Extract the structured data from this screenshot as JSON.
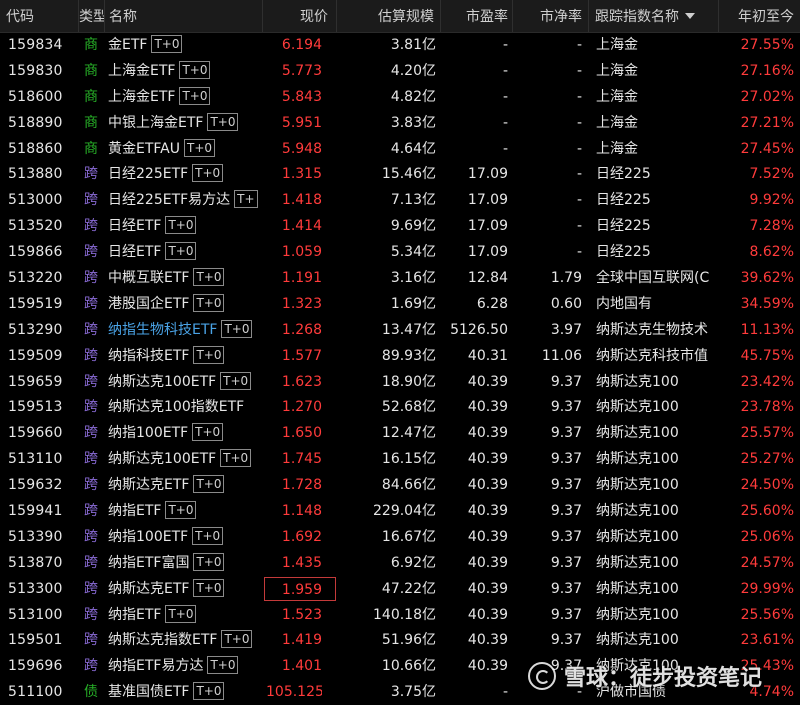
{
  "header": {
    "code": "代码",
    "type": "类型",
    "name": "名称",
    "price": "现价",
    "scale": "估算规模",
    "pe": "市盈率",
    "pb": "市净率",
    "index": "跟踪指数名称",
    "ytd": "年初至今"
  },
  "rows": [
    {
      "code": "159834",
      "tag": "商",
      "name": "金ETF",
      "t0": "T+0",
      "price": "6.194",
      "scale": "3.81亿",
      "pe": "-",
      "pb": "-",
      "index": "上海金",
      "ytd": "27.55%"
    },
    {
      "code": "159830",
      "tag": "商",
      "name": "上海金ETF",
      "t0": "T+0",
      "price": "5.773",
      "scale": "4.20亿",
      "pe": "-",
      "pb": "-",
      "index": "上海金",
      "ytd": "27.16%"
    },
    {
      "code": "518600",
      "tag": "商",
      "name": "上海金ETF",
      "t0": "T+0",
      "price": "5.843",
      "scale": "4.82亿",
      "pe": "-",
      "pb": "-",
      "index": "上海金",
      "ytd": "27.02%"
    },
    {
      "code": "518890",
      "tag": "商",
      "name": "中银上海金ETF",
      "t0": "T+0",
      "price": "5.951",
      "scale": "3.83亿",
      "pe": "-",
      "pb": "-",
      "index": "上海金",
      "ytd": "27.21%"
    },
    {
      "code": "518860",
      "tag": "商",
      "name": "黄金ETFAU",
      "t0": "T+0",
      "price": "5.948",
      "scale": "4.64亿",
      "pe": "-",
      "pb": "-",
      "index": "上海金",
      "ytd": "27.45%"
    },
    {
      "code": "513880",
      "tag": "跨",
      "name": "日经225ETF",
      "t0": "T+0",
      "price": "1.315",
      "scale": "15.46亿",
      "pe": "17.09",
      "pb": "-",
      "index": "日经225",
      "ytd": "7.52%"
    },
    {
      "code": "513000",
      "tag": "跨",
      "name": "日经225ETF易方达",
      "t0": "T+",
      "price": "1.418",
      "scale": "7.13亿",
      "pe": "17.09",
      "pb": "-",
      "index": "日经225",
      "ytd": "9.92%"
    },
    {
      "code": "513520",
      "tag": "跨",
      "name": "日经ETF",
      "t0": "T+0",
      "price": "1.414",
      "scale": "9.69亿",
      "pe": "17.09",
      "pb": "-",
      "index": "日经225",
      "ytd": "7.28%"
    },
    {
      "code": "159866",
      "tag": "跨",
      "name": "日经ETF",
      "t0": "T+0",
      "price": "1.059",
      "scale": "5.34亿",
      "pe": "17.09",
      "pb": "-",
      "index": "日经225",
      "ytd": "8.62%"
    },
    {
      "code": "513220",
      "tag": "跨",
      "name": "中概互联ETF",
      "t0": "T+0",
      "price": "1.191",
      "scale": "3.16亿",
      "pe": "12.84",
      "pb": "1.79",
      "index": "全球中国互联网(C",
      "ytd": "39.62%"
    },
    {
      "code": "159519",
      "tag": "跨",
      "name": "港股国企ETF",
      "t0": "T+0",
      "price": "1.323",
      "scale": "1.69亿",
      "pe": "6.28",
      "pb": "0.60",
      "index": "内地国有",
      "ytd": "34.59%"
    },
    {
      "code": "513290",
      "tag": "跨",
      "name": "纳指生物科技ETF",
      "t0": "T+0",
      "price": "1.268",
      "scale": "13.47亿",
      "pe": "5126.50",
      "pb": "3.97",
      "index": "纳斯达克生物技术",
      "ytd": "11.13%",
      "blue": true
    },
    {
      "code": "159509",
      "tag": "跨",
      "name": "纳指科技ETF",
      "t0": "T+0",
      "price": "1.577",
      "scale": "89.93亿",
      "pe": "40.31",
      "pb": "11.06",
      "index": "纳斯达克科技市值",
      "ytd": "45.75%"
    },
    {
      "code": "159659",
      "tag": "跨",
      "name": "纳斯达克100ETF",
      "t0": "T+0",
      "price": "1.623",
      "scale": "18.90亿",
      "pe": "40.39",
      "pb": "9.37",
      "index": "纳斯达克100",
      "ytd": "23.42%"
    },
    {
      "code": "159513",
      "tag": "跨",
      "name": "纳斯达克100指数ETF",
      "t0": "",
      "price": "1.270",
      "scale": "52.68亿",
      "pe": "40.39",
      "pb": "9.37",
      "index": "纳斯达克100",
      "ytd": "23.78%"
    },
    {
      "code": "159660",
      "tag": "跨",
      "name": "纳指100ETF",
      "t0": "T+0",
      "price": "1.650",
      "scale": "12.47亿",
      "pe": "40.39",
      "pb": "9.37",
      "index": "纳斯达克100",
      "ytd": "25.57%"
    },
    {
      "code": "513110",
      "tag": "跨",
      "name": "纳斯达克100ETF",
      "t0": "T+0",
      "price": "1.745",
      "scale": "16.15亿",
      "pe": "40.39",
      "pb": "9.37",
      "index": "纳斯达克100",
      "ytd": "25.27%"
    },
    {
      "code": "159632",
      "tag": "跨",
      "name": "纳斯达克ETF",
      "t0": "T+0",
      "price": "1.728",
      "scale": "84.66亿",
      "pe": "40.39",
      "pb": "9.37",
      "index": "纳斯达克100",
      "ytd": "24.50%"
    },
    {
      "code": "159941",
      "tag": "跨",
      "name": "纳指ETF",
      "t0": "T+0",
      "price": "1.148",
      "scale": "229.04亿",
      "pe": "40.39",
      "pb": "9.37",
      "index": "纳斯达克100",
      "ytd": "25.60%"
    },
    {
      "code": "513390",
      "tag": "跨",
      "name": "纳指100ETF",
      "t0": "T+0",
      "price": "1.692",
      "scale": "16.67亿",
      "pe": "40.39",
      "pb": "9.37",
      "index": "纳斯达克100",
      "ytd": "25.06%"
    },
    {
      "code": "513870",
      "tag": "跨",
      "name": "纳指ETF富国",
      "t0": "T+0",
      "price": "1.435",
      "scale": "6.92亿",
      "pe": "40.39",
      "pb": "9.37",
      "index": "纳斯达克100",
      "ytd": "24.57%"
    },
    {
      "code": "513300",
      "tag": "跨",
      "name": "纳斯达克ETF",
      "t0": "T+0",
      "price": "1.959",
      "scale": "47.22亿",
      "pe": "40.39",
      "pb": "9.37",
      "index": "纳斯达克100",
      "ytd": "29.99%",
      "selected": true
    },
    {
      "code": "513100",
      "tag": "跨",
      "name": "纳指ETF",
      "t0": "T+0",
      "price": "1.523",
      "scale": "140.18亿",
      "pe": "40.39",
      "pb": "9.37",
      "index": "纳斯达克100",
      "ytd": "25.56%"
    },
    {
      "code": "159501",
      "tag": "跨",
      "name": "纳斯达克指数ETF",
      "t0": "T+0",
      "price": "1.419",
      "scale": "51.96亿",
      "pe": "40.39",
      "pb": "9.37",
      "index": "纳斯达克100",
      "ytd": "23.61%"
    },
    {
      "code": "159696",
      "tag": "跨",
      "name": "纳指ETF易方达",
      "t0": "T+0",
      "price": "1.401",
      "scale": "10.66亿",
      "pe": "40.39",
      "pb": "9.37",
      "index": "纳斯达克100",
      "ytd": "25.43%"
    },
    {
      "code": "511100",
      "tag": "债",
      "name": "基准国债ETF",
      "t0": "T+0",
      "price": "105.125",
      "scale": "3.75亿",
      "pe": "-",
      "pb": "-",
      "index": "沪做市国债",
      "ytd": "4.74%"
    }
  ],
  "watermark": "雪球：徒步投资笔记"
}
